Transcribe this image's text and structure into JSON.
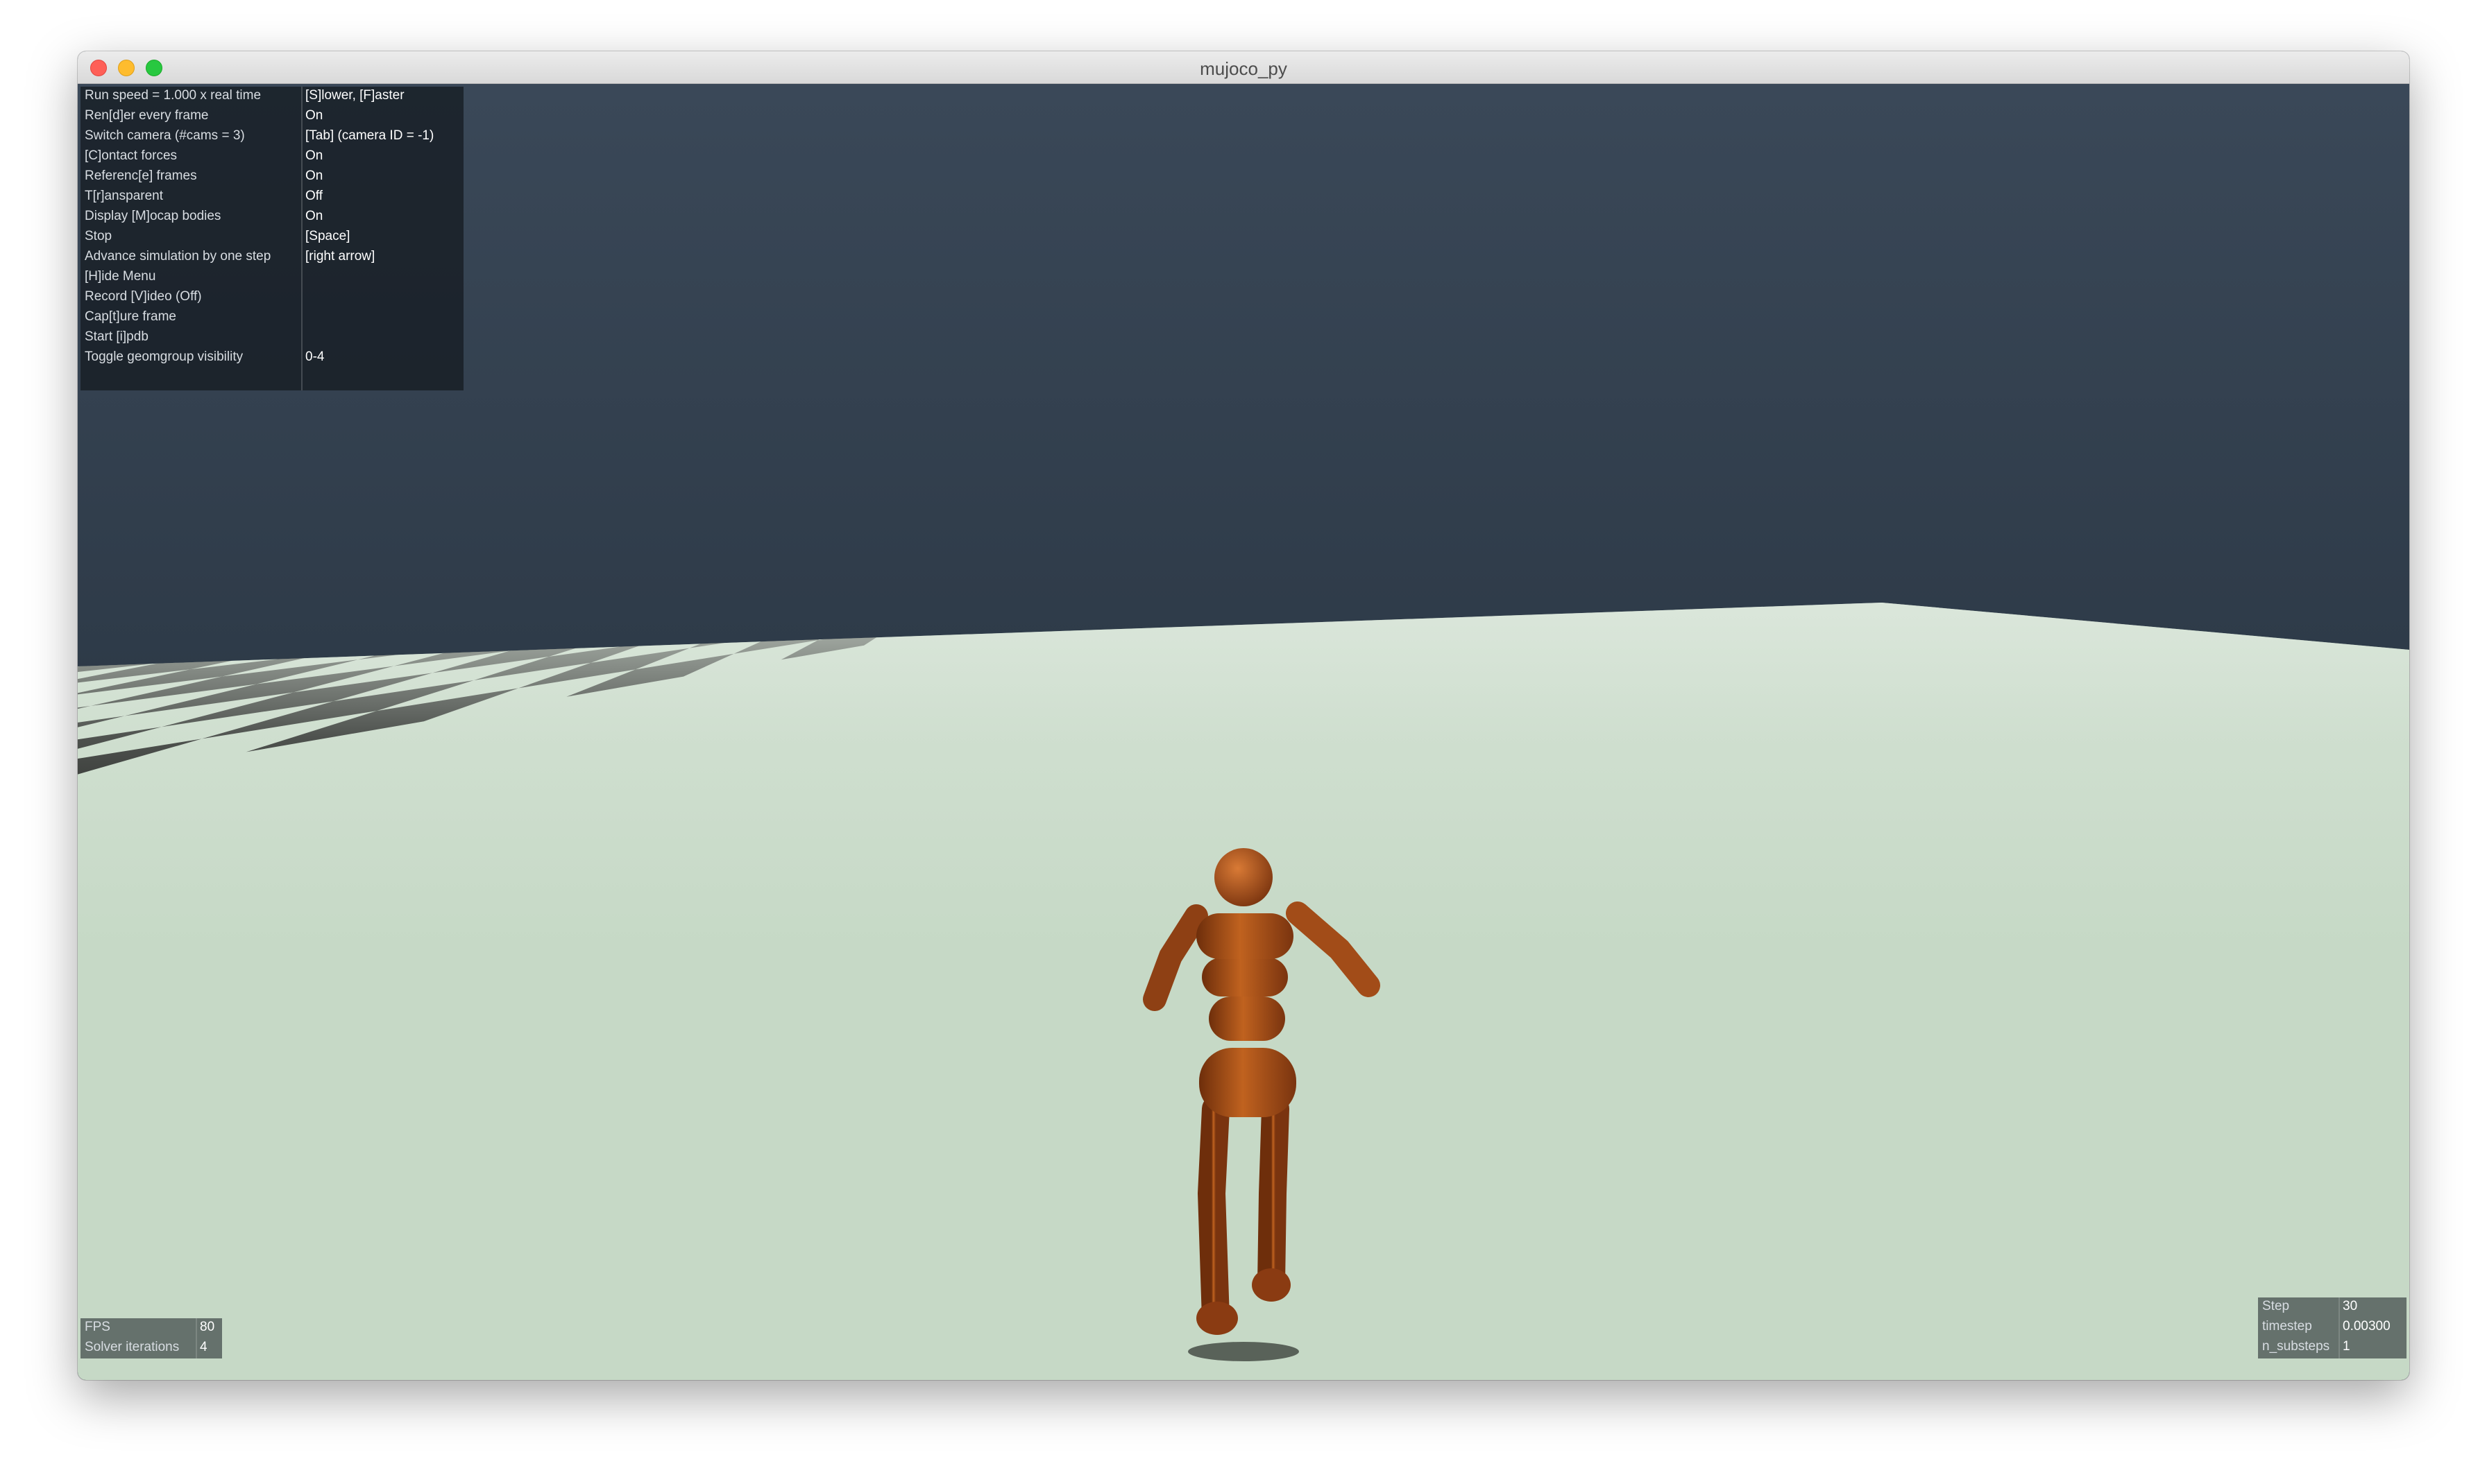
{
  "window": {
    "title": "mujoco_py"
  },
  "colors": {
    "sky_top": "#3a4858",
    "sky_bottom": "#1f2a35",
    "floor_light": "#c6d9c6",
    "floor_dark": "#000000",
    "humanoid": "#b9561e"
  },
  "menu": {
    "rows": [
      {
        "label": "Run speed = 1.000 x real time",
        "value": "[S]lower, [F]aster"
      },
      {
        "label": "Ren[d]er every frame",
        "value": "On"
      },
      {
        "label": "Switch camera (#cams = 3)",
        "value": "[Tab] (camera ID = -1)"
      },
      {
        "label": "[C]ontact forces",
        "value": "On"
      },
      {
        "label": "Referenc[e] frames",
        "value": "On"
      },
      {
        "label": "T[r]ansparent",
        "value": "Off"
      },
      {
        "label": "Display [M]ocap bodies",
        "value": "On"
      },
      {
        "label": "Stop",
        "value": "[Space]"
      },
      {
        "label": "Advance simulation by one step",
        "value": "[right arrow]"
      },
      {
        "label": "[H]ide Menu",
        "value": ""
      },
      {
        "label": "Record [V]ideo (Off)",
        "value": ""
      },
      {
        "label": "Cap[t]ure frame",
        "value": ""
      },
      {
        "label": "Start [i]pdb",
        "value": ""
      },
      {
        "label": "Toggle geomgroup visibility",
        "value": "0-4"
      }
    ]
  },
  "stats_left": {
    "rows": [
      {
        "label": "FPS",
        "value": "80"
      },
      {
        "label": "Solver iterations",
        "value": "4"
      }
    ]
  },
  "stats_right": {
    "rows": [
      {
        "label": "Step",
        "value": "30"
      },
      {
        "label": "timestep",
        "value": "0.00300"
      },
      {
        "label": "n_substeps",
        "value": "1"
      }
    ]
  }
}
